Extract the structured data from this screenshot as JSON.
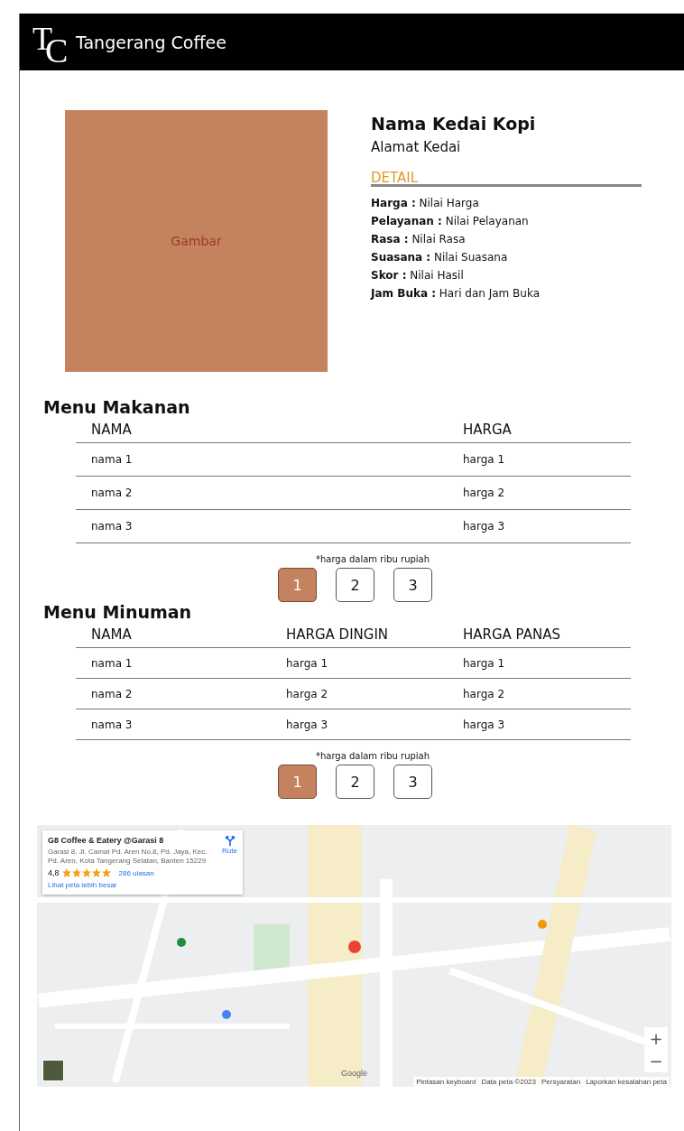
{
  "header": {
    "logo": {
      "letter_1": "T",
      "letter_2": "C"
    },
    "title": "Tangerang Coffee"
  },
  "shop": {
    "image_label": "Gambar",
    "name": "Nama Kedai Kopi",
    "address": "Alamat Kedai",
    "detail_heading": "DETAIL",
    "details": [
      {
        "label": "Harga :",
        "value": "Nilai Harga"
      },
      {
        "label": "Pelayanan :",
        "value": "Nilai Pelayanan"
      },
      {
        "label": "Rasa :",
        "value": "Nilai Rasa"
      },
      {
        "label": "Suasana :",
        "value": "Nilai Suasana"
      },
      {
        "label": "Skor :",
        "value": "Nilai Hasil"
      },
      {
        "label": "Jam Buka :",
        "value": "Hari dan Jam Buka"
      }
    ]
  },
  "food_menu": {
    "title": "Menu Makanan",
    "columns": [
      "NAMA",
      "HARGA"
    ],
    "rows": [
      [
        "nama 1",
        "harga 1"
      ],
      [
        "nama 2",
        "harga 2"
      ],
      [
        "nama 3",
        "harga 3"
      ]
    ],
    "note": "*harga dalam ribu rupiah",
    "pages": [
      {
        "label": "1",
        "selected": true
      },
      {
        "label": "2",
        "selected": false
      },
      {
        "label": "3",
        "selected": false
      }
    ]
  },
  "drink_menu": {
    "title": "Menu Minuman",
    "columns": [
      "NAMA",
      "HARGA DINGIN",
      "HARGA PANAS"
    ],
    "rows": [
      [
        "nama 1",
        "harga 1",
        "harga 1"
      ],
      [
        "nama 2",
        "harga 2",
        "harga 2"
      ],
      [
        "nama 3",
        "harga 3",
        "harga 3"
      ]
    ],
    "note": "*harga dalam ribu rupiah",
    "pages": [
      {
        "label": "1",
        "selected": true
      },
      {
        "label": "2",
        "selected": false
      },
      {
        "label": "3",
        "selected": false
      }
    ]
  },
  "map": {
    "card": {
      "title": "G8 Coffee & Eatery @Garasi 8",
      "address": "Garasi 8, Jl. Camat Pd. Aren No.8, Pd. Jaya, Kec. Pd. Aren, Kota Tangerang Selatan, Banten 15229",
      "rating": "4,8",
      "stars": 5,
      "reviews": "286 ulasan",
      "route": "Rute",
      "larger_map": "Lihat peta lebih besar"
    },
    "zoom_in": "+",
    "zoom_out": "−",
    "logo": "Google",
    "footer": [
      "Pintasan keyboard",
      "Data peta ©2023",
      "Persyaratan",
      "Laporkan kesalahan peta"
    ]
  }
}
